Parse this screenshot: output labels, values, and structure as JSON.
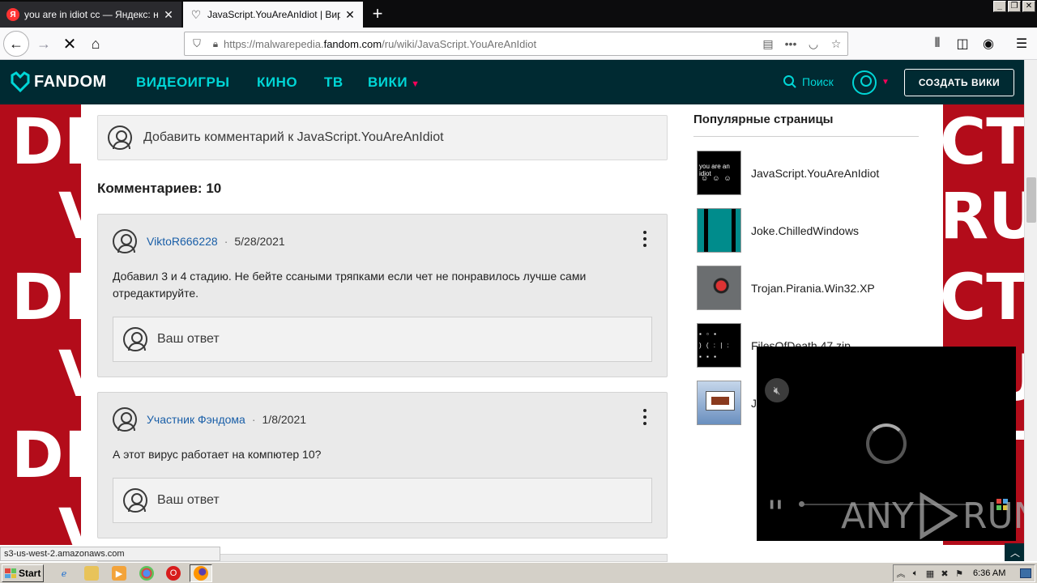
{
  "browser": {
    "tabs": [
      {
        "title": "you are in idiot cc — Яндекс: наш",
        "favicon": "Я"
      },
      {
        "title": "JavaScript.YouAreAnIdiot | Вирус",
        "favicon": "fandom-heart-icon"
      }
    ],
    "url_prefix": "https://malwarepedia.",
    "url_domain": "fandom.com",
    "url_path": "/ru/wiki/JavaScript.YouAreAnIdiot",
    "status_link": "s3-us-west-2.amazonaws.com"
  },
  "fandom": {
    "logo": "FANDOM",
    "nav": [
      "ВИДЕОИГРЫ",
      "КИНО",
      "ТВ",
      "ВИКИ"
    ],
    "search_label": "Поиск",
    "create_wiki": "СОЗДАТЬ ВИКИ",
    "colors": {
      "header_bg": "#002a32",
      "accent": "#00d6d6",
      "caret": "#fa005a",
      "page_bg": "#b30c1a"
    }
  },
  "background_words": [
    "DET",
    "V",
    "DET",
    "V",
    "DET",
    "V",
    "CTI",
    "RUS",
    "CTI",
    "RUS",
    "CTI"
  ],
  "comments": {
    "add_placeholder": "Добавить комментарий к JavaScript.YouAreAnIdiot",
    "count_label": "Комментариев: 10",
    "reply_label": "Ваш ответ",
    "items": [
      {
        "author": "ViktoR666228",
        "date": "5/28/2021",
        "text": "Добавил 3 и 4 стадию. Не бейте ссаными тряпками если чет не понравилось лучше сами отредактируйте."
      },
      {
        "author": "Участник Фэндома",
        "date": "1/8/2021",
        "text": "А этот вирус работает на компютер 10?"
      }
    ]
  },
  "sidebar": {
    "title": "Популярные страницы",
    "items": [
      {
        "label": "JavaScript.YouAreAnIdiot",
        "thumb_text": "you are an idiot"
      },
      {
        "label": "Joke.ChilledWindows"
      },
      {
        "label": "Trojan.Pirania.Win32.XP"
      },
      {
        "label": "FilesOfDeath.47.zip"
      },
      {
        "label": "J"
      }
    ]
  },
  "video": {
    "watermark_left": "ANY",
    "watermark_right": "RUN"
  },
  "taskbar": {
    "start_label": "Start",
    "clock": "6:36 AM"
  }
}
